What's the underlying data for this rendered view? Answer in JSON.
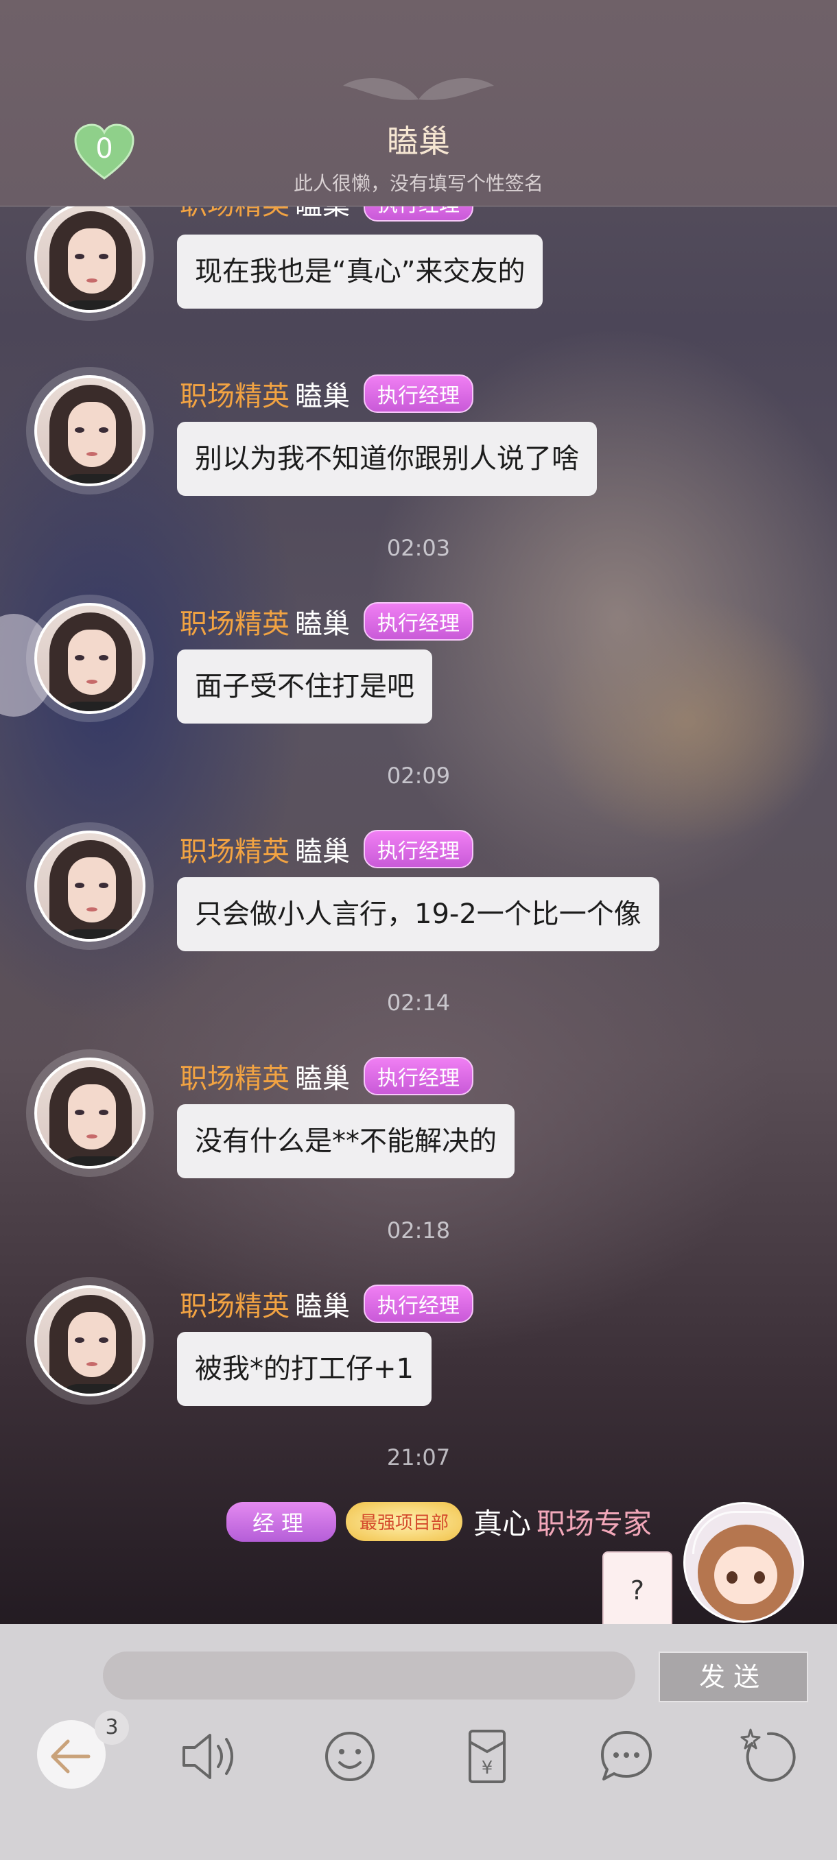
{
  "header": {
    "like_count": "0",
    "title": "瞌巢",
    "subtitle": "此人很懒，没有填写个性签名"
  },
  "messages": [
    {
      "nickname": "职场精英",
      "username": "瞌巢",
      "badge": "执行经理",
      "text": "现在我也是“真心”来交友的"
    },
    {
      "nickname": "职场精英",
      "username": "瞌巢",
      "badge": "执行经理",
      "text": "别以为我不知道你跟别人说了啥"
    },
    {
      "nickname": "职场精英",
      "username": "瞌巢",
      "badge": "执行经理",
      "text": "面子受不住打是吧"
    },
    {
      "nickname": "职场精英",
      "username": "瞌巢",
      "badge": "执行经理",
      "text": "只会做小人言行，19-2一个比一个像"
    },
    {
      "nickname": "职场精英",
      "username": "瞌巢",
      "badge": "执行经理",
      "text": "没有什么是**不能解决的"
    },
    {
      "nickname": "职场精英",
      "username": "瞌巢",
      "badge": "执行经理",
      "text": "被我*的打工仔+1"
    }
  ],
  "timestamps": [
    "02:03",
    "02:09",
    "02:14",
    "02:18",
    "21:07"
  ],
  "self": {
    "badge_rank": "经理",
    "badge_department": "最强项目部",
    "name": "真心",
    "title": "职场专家",
    "pending_bubble": "?"
  },
  "composer": {
    "input_value": "",
    "send_label": "发送"
  },
  "toolbar": {
    "back_badge": "3",
    "icons": [
      "back-arrow-icon",
      "voice-icon",
      "emoji-icon",
      "red-packet-icon",
      "chat-bubble-icon",
      "refresh-icon"
    ]
  }
}
